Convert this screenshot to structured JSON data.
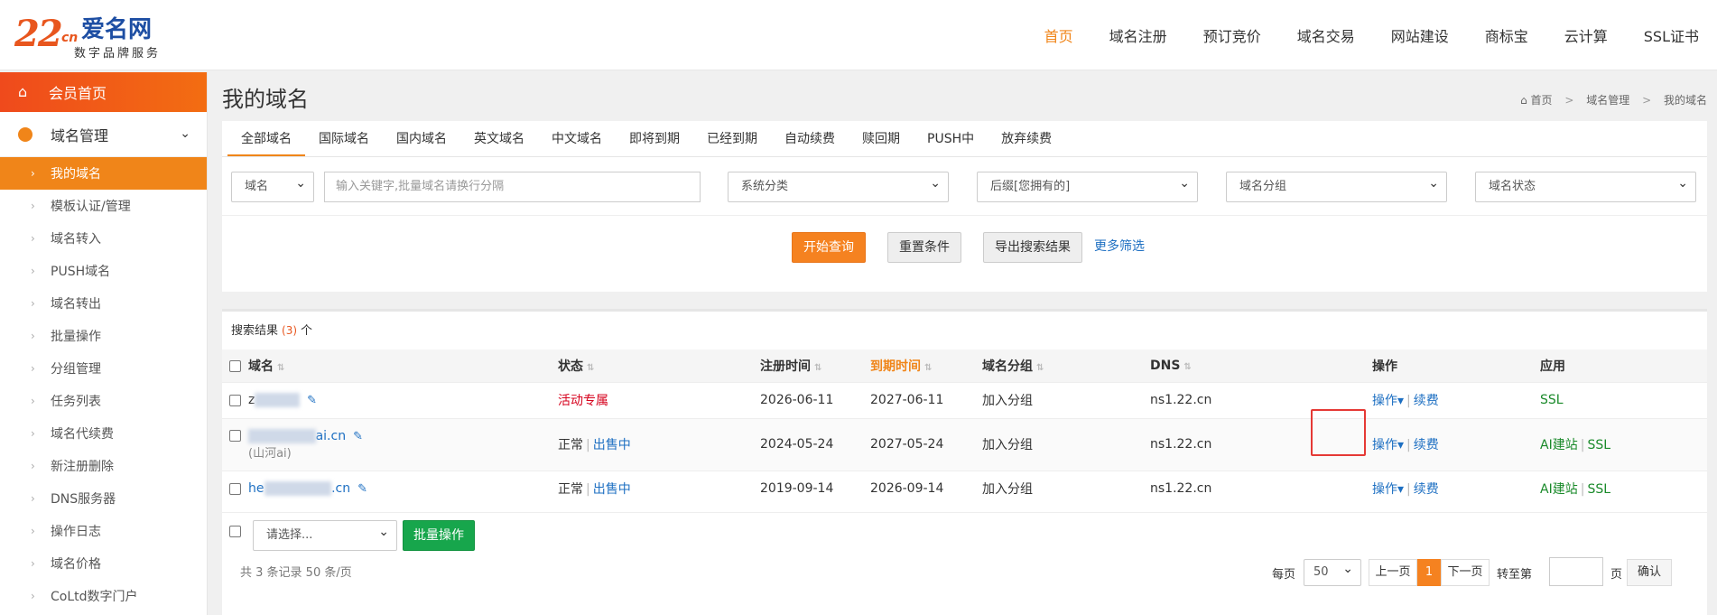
{
  "logo": {
    "mark": "22",
    "cn": "cn",
    "name": "爱名网",
    "sub": "数字品牌服务"
  },
  "topnav": [
    "首页",
    "域名注册",
    "预订竞价",
    "域名交易",
    "网站建设",
    "商标宝",
    "云计算",
    "SSL证书"
  ],
  "sidebar": {
    "home": "会员首页",
    "group": "域名管理",
    "items": [
      "我的域名",
      "模板认证/管理",
      "域名转入",
      "PUSH域名",
      "域名转出",
      "批量操作",
      "分组管理",
      "任务列表",
      "域名代续费",
      "新注册删除",
      "DNS服务器",
      "操作日志",
      "域名价格",
      "CoLtd数字门户"
    ]
  },
  "page": {
    "title": "我的域名",
    "crumb": [
      "首页",
      "域名管理",
      "我的域名"
    ]
  },
  "tabs": [
    "全部域名",
    "国际域名",
    "国内域名",
    "英文域名",
    "中文域名",
    "即将到期",
    "已经到期",
    "自动续费",
    "赎回期",
    "PUSH中",
    "放弃续费"
  ],
  "filters": {
    "field": "域名",
    "placeholder": "输入关键字,批量域名请换行分隔",
    "category": "系统分类",
    "suffix": "后缀[您拥有的]",
    "group": "域名分组",
    "status": "域名状态"
  },
  "buttons": {
    "search": "开始查询",
    "reset": "重置条件",
    "export": "导出搜索结果",
    "more": "更多筛选"
  },
  "results": {
    "label": "搜索结果",
    "count": "(3)",
    "unit": "个"
  },
  "columns": [
    "域名",
    "状态",
    "注册时间",
    "到期时间",
    "域名分组",
    "DNS",
    "操作",
    "应用"
  ],
  "rows": [
    {
      "domain_a": "z",
      "domain_b": "xxxxxx",
      "domain_c": "",
      "note": "",
      "status": "活动专属",
      "sale": "",
      "reg": "2026-06-11",
      "exp": "2027-06-11",
      "group": "加入分组",
      "dns": "ns1.22.cn",
      "op": "操作▾",
      "renew": "续费",
      "ai": "",
      "ssl": "SSL"
    },
    {
      "domain_a": "",
      "domain_b": "xxxxxxxxx",
      "domain_c": "ai.cn",
      "note": "(山河ai)",
      "status": "正常",
      "sale": "出售中",
      "reg": "2024-05-24",
      "exp": "2027-05-24",
      "group": "加入分组",
      "dns": "ns1.22.cn",
      "op": "操作▾",
      "renew": "续费",
      "ai": "AI建站",
      "ssl": "SSL"
    },
    {
      "domain_a": "he",
      "domain_b": "xxxxxxxxx",
      "domain_c": ".cn",
      "note": "",
      "status": "正常",
      "sale": "出售中",
      "reg": "2019-09-14",
      "exp": "2026-09-14",
      "group": "加入分组",
      "dns": "ns1.22.cn",
      "op": "操作▾",
      "renew": "续费",
      "ai": "AI建站",
      "ssl": "SSL"
    }
  ],
  "batch": {
    "select": "请选择...",
    "button": "批量操作"
  },
  "footer": {
    "summary": "共 3 条记录 50 条/页",
    "per_page_label": "每页",
    "per_page": "50",
    "prev": "上一页",
    "current": "1",
    "next": "下一页",
    "goto": "转至第",
    "page_unit": "页",
    "confirm": "确认"
  }
}
